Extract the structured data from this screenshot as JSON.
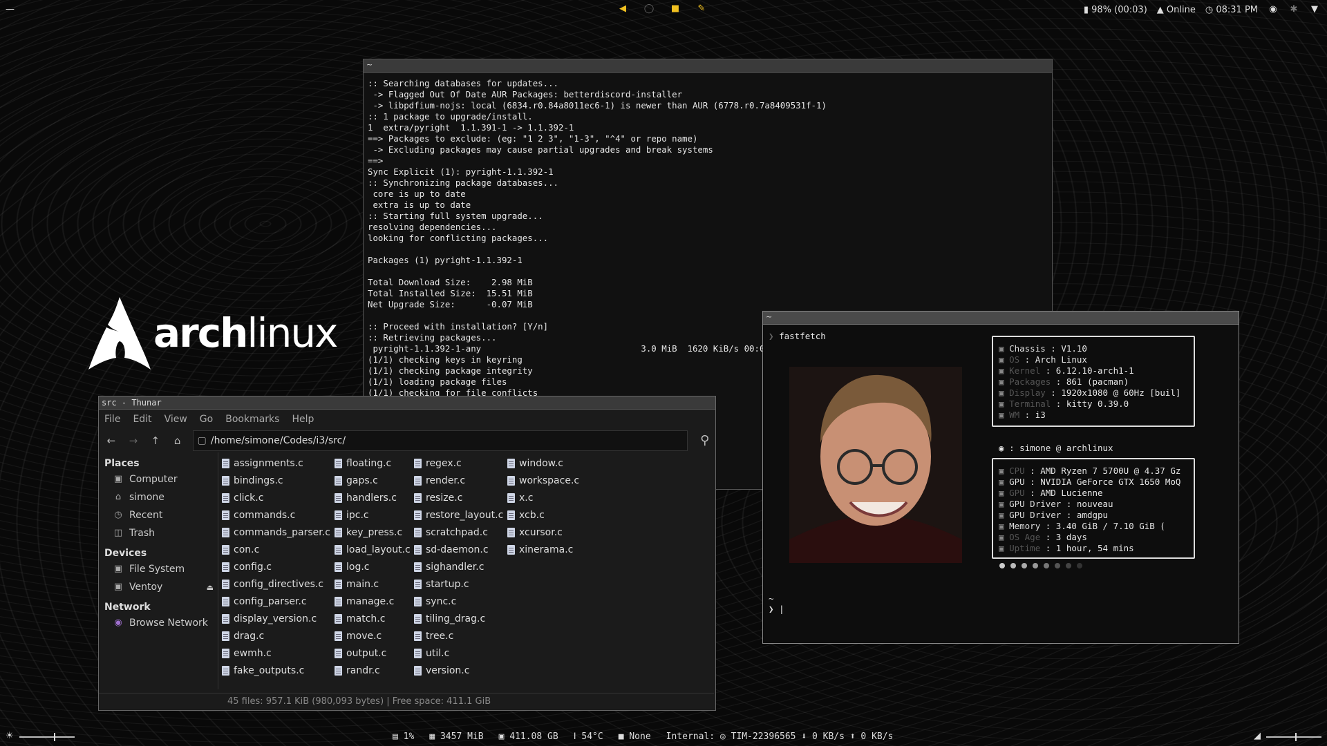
{
  "topbar": {
    "left_mark": "—",
    "battery": "98% (00:03)",
    "network": "Online",
    "clock": "08:31 PM"
  },
  "bottombar": {
    "cpu": "1%",
    "memory": "3457 MiB",
    "disk": "411.08 GB",
    "temp": "54°C",
    "media": "None",
    "wifi": "Internal: ◎ TIM-22396565 ⬇ 0 KB/s ⬆ 0 KB/s"
  },
  "archlogo": {
    "bold": "arch",
    "light": "linux"
  },
  "terminal": {
    "title": "~",
    "lines": [
      ":: Searching databases for updates...",
      " -> Flagged Out Of Date AUR Packages: betterdiscord-installer",
      " -> libpdfium-nojs: local (6834.r0.84a8011ec6-1) is newer than AUR (6778.r0.7a8409531f-1)",
      ":: 1 package to upgrade/install.",
      "1  extra/pyright  1.1.391-1 -> 1.1.392-1",
      "==> Packages to exclude: (eg: \"1 2 3\", \"1-3\", \"^4\" or repo name)",
      " -> Excluding packages may cause partial upgrades and break systems",
      "==>",
      "Sync Explicit (1): pyright-1.1.392-1",
      ":: Synchronizing package databases...",
      " core is up to date",
      " extra is up to date",
      ":: Starting full system upgrade...",
      "resolving dependencies...",
      "looking for conflicting packages...",
      "",
      "Packages (1) pyright-1.1.392-1",
      "",
      "Total Download Size:    2.98 MiB",
      "Total Installed Size:  15.51 MiB",
      "Net Upgrade Size:      -0.07 MiB",
      "",
      ":: Proceed with installation? [Y/n]",
      ":: Retrieving packages...",
      " pyright-1.1.392-1-any                               3.0 MiB  1620 KiB/s 00:0",
      "(1/1) checking keys in keyring",
      "(1/1) checking package integrity",
      "(1/1) loading package files",
      "(1/1) checking for file conflicts"
    ]
  },
  "thunar": {
    "title": "src - Thunar",
    "menu": [
      "File",
      "Edit",
      "View",
      "Go",
      "Bookmarks",
      "Help"
    ],
    "path": "/home/simone/Codes/i3/src/",
    "sidebar": {
      "places_label": "Places",
      "places": [
        "Computer",
        "simone",
        "Recent",
        "Trash"
      ],
      "devices_label": "Devices",
      "devices": [
        "File System",
        "Ventoy"
      ],
      "network_label": "Network",
      "network": [
        "Browse Network"
      ]
    },
    "columns": [
      [
        "assignments.c",
        "bindings.c",
        "click.c",
        "commands.c",
        "commands_parser.c",
        "con.c",
        "config.c",
        "config_directives.c",
        "config_parser.c",
        "display_version.c",
        "drag.c",
        "ewmh.c",
        "fake_outputs.c"
      ],
      [
        "floating.c",
        "gaps.c",
        "handlers.c",
        "ipc.c",
        "key_press.c",
        "load_layout.c",
        "log.c",
        "main.c",
        "manage.c",
        "match.c",
        "move.c",
        "output.c",
        "randr.c"
      ],
      [
        "regex.c",
        "render.c",
        "resize.c",
        "restore_layout.c",
        "scratchpad.c",
        "sd-daemon.c",
        "sighandler.c",
        "startup.c",
        "sync.c",
        "tiling_drag.c",
        "tree.c",
        "util.c",
        "version.c"
      ],
      [
        "window.c",
        "workspace.c",
        "x.c",
        "xcb.c",
        "xcursor.c",
        "xinerama.c"
      ]
    ],
    "status": "45 files: 957.1 KiB (980,093 bytes)  |  Free space: 411.1 GiB"
  },
  "fastfetch": {
    "title": "~",
    "command": "fastfetch",
    "rows1": [
      {
        "k": "Chassis",
        "v": ": V1.10",
        "dim": false
      },
      {
        "k": "OS",
        "v": ": Arch Linux",
        "dim": true
      },
      {
        "k": "Kernel",
        "v": ": 6.12.10-arch1-1",
        "dim": true
      },
      {
        "k": "Packages",
        "v": ": 861 (pacman)",
        "dim": true
      },
      {
        "k": "Display",
        "v": ": 1920x1080 @ 60Hz [buil]",
        "dim": true
      },
      {
        "k": "Terminal",
        "v": ": kitty 0.39.0",
        "dim": true
      },
      {
        "k": "WM",
        "v": ": i3",
        "dim": true
      }
    ],
    "user": ": simone @ archlinux",
    "rows2": [
      {
        "k": "CPU",
        "v": ": AMD Ryzen 7 5700U @ 4.37 Gz",
        "dim": true
      },
      {
        "k": "GPU",
        "v": ": NVIDIA GeForce GTX 1650 MoQ",
        "dim": false
      },
      {
        "k": "GPU",
        "v": ": AMD Lucienne",
        "dim": true
      },
      {
        "k": "GPU Driver",
        "v": ": nouveau",
        "dim": false
      },
      {
        "k": "GPU Driver",
        "v": ": amdgpu",
        "dim": false
      },
      {
        "k": "Memory",
        "v": ": 3.40 GiB / 7.10 GiB (",
        "dim": false
      },
      {
        "k": "OS Age",
        "v": ": 3 days",
        "dim": true
      },
      {
        "k": "Uptime",
        "v": ": 1 hour, 54 mins",
        "dim": true
      }
    ],
    "dot_colors": [
      "#cccccc",
      "#bbbbbb",
      "#aaaaaa",
      "#999999",
      "#777777",
      "#555555",
      "#444444",
      "#333333"
    ]
  }
}
